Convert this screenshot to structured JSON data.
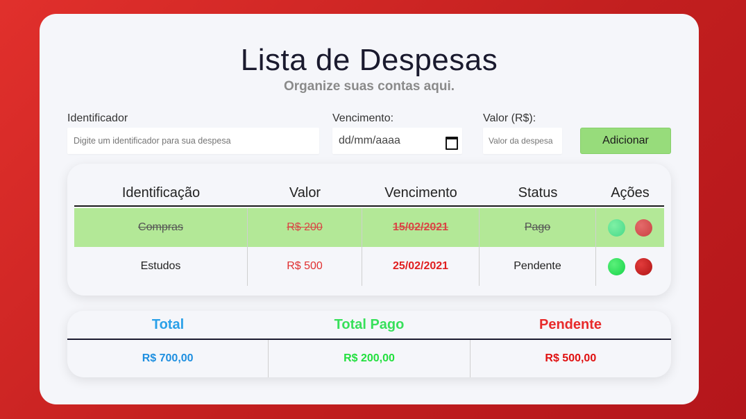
{
  "header": {
    "title": "Lista de Despesas",
    "subtitle": "Organize suas contas aqui."
  },
  "form": {
    "identificador_label": "Identificador",
    "identificador_placeholder": "Digite um identificador para sua despesa",
    "vencimento_label": "Vencimento:",
    "vencimento_value": "dd/mm/aaaa",
    "valor_label": "Valor (R$):",
    "valor_placeholder": "Valor da despesa",
    "add_button": "Adicionar"
  },
  "table": {
    "headers": [
      "Identificação",
      "Valor",
      "Vencimento",
      "Status",
      "Ações"
    ],
    "rows": [
      {
        "identificacao": "Compras",
        "valor": "R$ 200",
        "vencimento": "15/02/2021",
        "status": "Pago",
        "paid": true
      },
      {
        "identificacao": "Estudos",
        "valor": "R$ 500",
        "vencimento": "25/02/2021",
        "status": "Pendente",
        "paid": false
      }
    ]
  },
  "summary": {
    "headers": [
      "Total",
      "Total Pago",
      "Pendente"
    ],
    "values": [
      "R$ 700,00",
      "R$ 200,00",
      "R$ 500,00"
    ],
    "colors": [
      "#2aa0e8",
      "#37e05a",
      "#e82a2a"
    ]
  },
  "colors": {
    "background": "#c9221f",
    "paid_row": "#b3e897",
    "add_button": "#97dc7b"
  }
}
